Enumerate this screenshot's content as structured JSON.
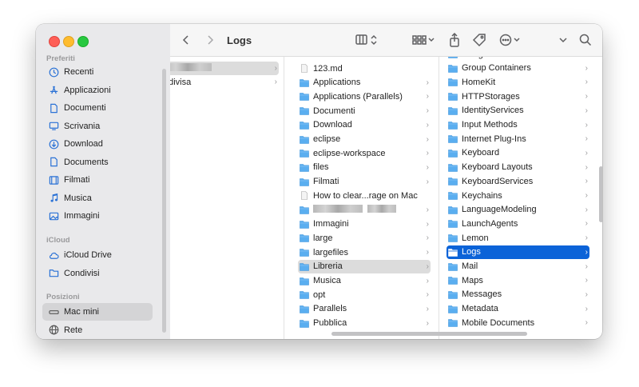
{
  "toolbar": {
    "title": "Logs",
    "back_icon": "chevron-left-icon",
    "forward_icon": "chevron-right-icon"
  },
  "sidebar": {
    "top_section": "Preferiti",
    "icloud_section": "iCloud",
    "locations_section": "Posizioni",
    "favorites": [
      {
        "label": "Recenti",
        "icon": "clock-icon"
      },
      {
        "label": "Applicazioni",
        "icon": "applications-icon"
      },
      {
        "label": "Documenti",
        "icon": "document-icon"
      },
      {
        "label": "Scrivania",
        "icon": "desktop-icon"
      },
      {
        "label": "Download",
        "icon": "download-icon"
      },
      {
        "label": "Documents",
        "icon": "document-icon"
      },
      {
        "label": "Filmati",
        "icon": "film-icon"
      },
      {
        "label": "Musica",
        "icon": "music-icon"
      },
      {
        "label": "Immagini",
        "icon": "image-icon"
      }
    ],
    "icloud": [
      {
        "label": "iCloud Drive",
        "icon": "cloud-icon"
      },
      {
        "label": "Condivisi",
        "icon": "shared-folder-icon"
      }
    ],
    "locations": [
      {
        "label": "Mac mini",
        "icon": "mac-mini-icon"
      },
      {
        "label": "Rete",
        "icon": "network-icon"
      }
    ]
  },
  "column1": {
    "items": [
      "ndivisa"
    ]
  },
  "column2": {
    "items": [
      {
        "label": "123.md",
        "type": "file"
      },
      {
        "label": "Applications",
        "type": "folder"
      },
      {
        "label": "Applications (Parallels)",
        "type": "folder"
      },
      {
        "label": "Documenti",
        "type": "folder"
      },
      {
        "label": "Download",
        "type": "folder"
      },
      {
        "label": "eclipse",
        "type": "folder"
      },
      {
        "label": "eclipse-workspace",
        "type": "folder"
      },
      {
        "label": "files",
        "type": "folder"
      },
      {
        "label": "Filmati",
        "type": "folder"
      },
      {
        "label": "How to clear...rage on Mac",
        "type": "file"
      },
      {
        "label": "",
        "type": "blurred"
      },
      {
        "label": "Immagini",
        "type": "folder"
      },
      {
        "label": "large",
        "type": "folder"
      },
      {
        "label": "largefiles",
        "type": "folder"
      },
      {
        "label": "Libreria",
        "type": "folder"
      },
      {
        "label": "Musica",
        "type": "folder"
      },
      {
        "label": "opt",
        "type": "folder"
      },
      {
        "label": "Parallels",
        "type": "folder"
      },
      {
        "label": "Pubblica",
        "type": "folder"
      }
    ]
  },
  "column3": {
    "items": [
      {
        "label": "Google"
      },
      {
        "label": "Group Containers"
      },
      {
        "label": "HomeKit"
      },
      {
        "label": "HTTPStorages"
      },
      {
        "label": "IdentityServices"
      },
      {
        "label": "Input Methods"
      },
      {
        "label": "Internet Plug-Ins"
      },
      {
        "label": "Keyboard"
      },
      {
        "label": "Keyboard Layouts"
      },
      {
        "label": "KeyboardServices"
      },
      {
        "label": "Keychains"
      },
      {
        "label": "LanguageModeling"
      },
      {
        "label": "LaunchAgents"
      },
      {
        "label": "Lemon"
      },
      {
        "label": "Logs"
      },
      {
        "label": "Mail"
      },
      {
        "label": "Maps"
      },
      {
        "label": "Messages"
      },
      {
        "label": "Metadata"
      },
      {
        "label": "Mobile Documents"
      }
    ]
  },
  "colors": {
    "accent": "#0b63d8",
    "folder": "#5aaef0",
    "sidebar_icon": "#2b72d6"
  }
}
